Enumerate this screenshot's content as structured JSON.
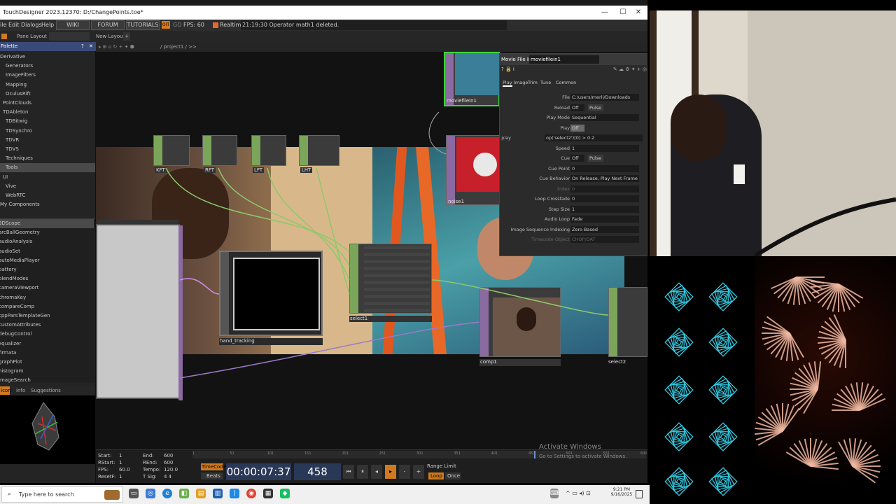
{
  "window": {
    "title": "TouchDesigner 2023.12370: D:/ChangePoints.toe*",
    "controls": [
      "—",
      "☐",
      "✕"
    ]
  },
  "menu": {
    "items": [
      "File",
      "Edit",
      "Dialogs",
      "Help"
    ],
    "wiki": "WIKI",
    "forum": "FORUM",
    "tutorials": "TUTORIALS",
    "oit": "OIT",
    "go": "GO",
    "fps": "FPS: 60",
    "realtime": "Realtime",
    "status": "21:19:30 Operator math1 deleted."
  },
  "pane": {
    "layout_label": "Pane Layout",
    "new_layout": "New Layout"
  },
  "palette": {
    "header": "Palette",
    "items": [
      "Derivative",
      "Generators",
      "ImageFilters",
      "Mapping",
      "OculusRift",
      "PointClouds",
      "TDAbleton",
      "TDBitwig",
      "TDSynchro",
      "TDVR",
      "TDVS",
      "Techniques",
      "Tools",
      "UI",
      "Vive",
      "WebRTC",
      "My Components"
    ],
    "selected_index": 12,
    "tools": [
      "3DScope",
      "arcBallGeometry",
      "audioAnalysis",
      "audioSet",
      "autoMediaPlayer",
      "battery",
      "blendModes",
      "cameraViewport",
      "chromaKey",
      "compareComp",
      "cppParsTemplateGen",
      "customAttributes",
      "debugControl",
      "equalizer",
      "firmata",
      "graphPlot",
      "histogram",
      "imageSearch"
    ],
    "tabs": [
      "Icon",
      "Info",
      "Suggestions"
    ]
  },
  "network": {
    "path": "/ project1 / >>",
    "nodes": {
      "moviefilein1": "moviefilein1",
      "noise1": "noise1",
      "hand_tracking": "hand_tracking",
      "select1": "select1",
      "comp1": "comp1",
      "select2": "select2"
    },
    "top_chops": [
      "KFT",
      "RFT",
      "LFT",
      "LHT"
    ]
  },
  "params": {
    "op_type": "Movie File In",
    "op_name": "moviefilein1",
    "tabs": [
      "Play",
      "Image",
      "Trim",
      "Tune",
      "Common"
    ],
    "rows": [
      {
        "label": "File",
        "value": "C:/users/merli/Downloads"
      },
      {
        "label": "Reload",
        "value": "Off"
      },
      {
        "label": "Play Mode",
        "value": "Sequential"
      },
      {
        "label": "Play",
        "value": "Off"
      },
      {
        "label": "play",
        "value": "op('select2')[0] > 0.2"
      },
      {
        "label": "Speed",
        "value": "1"
      },
      {
        "label": "Cue",
        "value": "Off"
      },
      {
        "label": "Cue Point",
        "value": "0"
      },
      {
        "label": "Cue Behavior",
        "value": "On Release, Play Next Frame"
      },
      {
        "label": "Index",
        "value": "0"
      },
      {
        "label": "Loop Crossfade",
        "value": "0"
      },
      {
        "label": "Step Size",
        "value": "1"
      },
      {
        "label": "Audio Loop",
        "value": "Fade"
      },
      {
        "label": "Image Sequence Indexing",
        "value": "Zero Based"
      },
      {
        "label": "Timecode Object",
        "value": "CHOP/DAT"
      }
    ],
    "pulse": "Pulse",
    "percent": "%"
  },
  "timeline": {
    "start": "Start:",
    "start_val": "1",
    "rstart": "RStart:",
    "rstart_val": "1",
    "fps": "FPS:",
    "fps_val": "60.0",
    "resetf": "ResetF:",
    "resetf_val": "1",
    "end": "End:",
    "end_val": "600",
    "rend": "REnd:",
    "rend_val": "600",
    "tempo": "Tempo:",
    "tempo_val": "120.0",
    "tsig": "T Sig:",
    "tsig_val": "4 4",
    "timecode_label": "TimeCode",
    "beats_label": "Beats",
    "timecode": "00:00:07:37",
    "frame": "458",
    "range_limit": "Range Limit",
    "loop": "Loop",
    "once": "Once",
    "ruler": [
      "1",
      "51",
      "101",
      "151",
      "201",
      "251",
      "301",
      "351",
      "401",
      "451",
      "501",
      "551",
      "600"
    ],
    "playhead_fraction": 0.763
  },
  "activate": {
    "line1": "Activate Windows",
    "line2": "Go to Settings to activate Windows."
  },
  "taskbar": {
    "search_placeholder": "Type here to search",
    "time": "9:21 PM",
    "date": "9/16/2025"
  },
  "colors": {
    "palette_header": "#3a4a78",
    "chop_green": "#7aa55a",
    "top_purple": "#8a6aa0",
    "timecode_bg": "#2a3858",
    "art_cyan": "#33c8e0",
    "art_peach": "#f0b8a0"
  }
}
